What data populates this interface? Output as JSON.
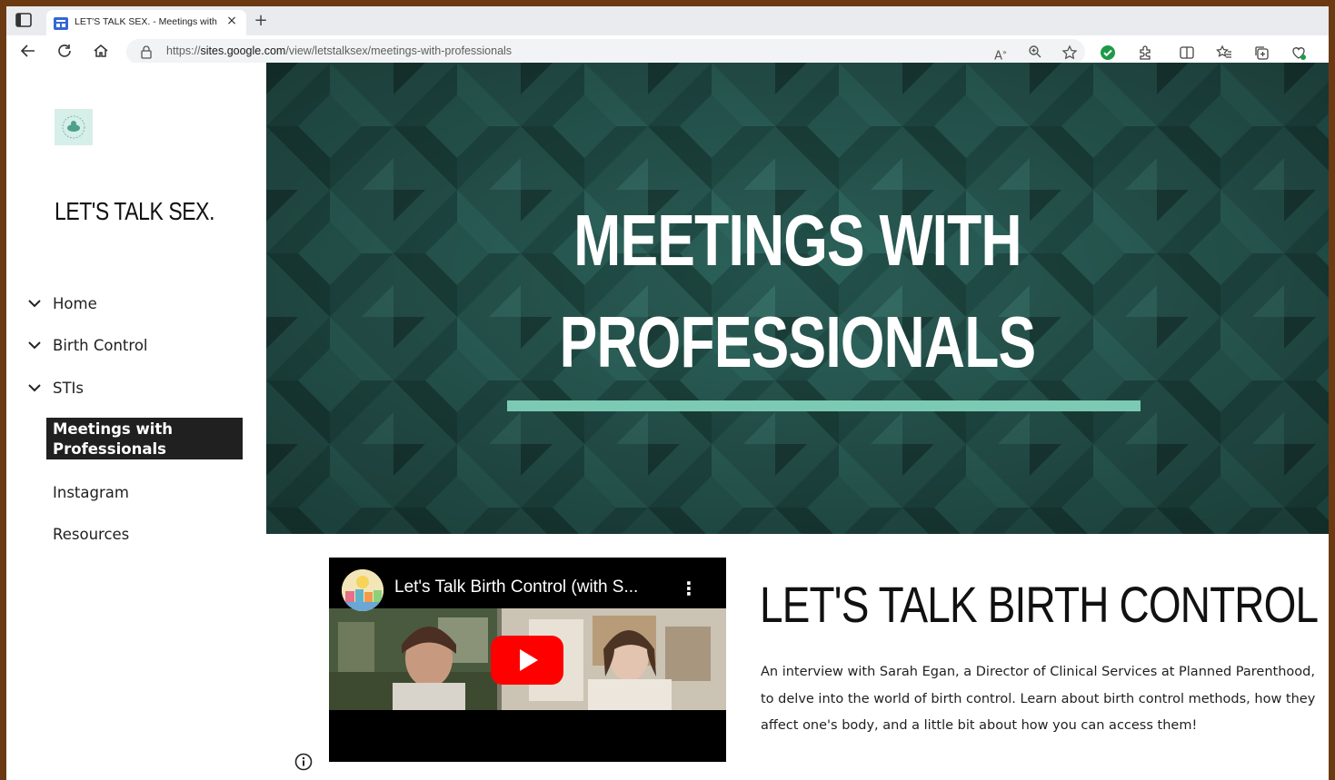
{
  "browser": {
    "tab_title": "LET'S TALK SEX. - Meetings with",
    "tab_close": "×",
    "new_tab": "+",
    "url_scheme": "https://",
    "url_host": "sites.google.com",
    "url_path": "/view/letstalksex/meetings-with-professionals",
    "icons": [
      "tab-actions-icon",
      "back-icon",
      "refresh-icon",
      "home-icon",
      "lock-icon",
      "read-aloud-icon",
      "zoom-icon",
      "favorite-star-icon",
      "extension-check-icon",
      "extensions-icon",
      "split-screen-icon",
      "favorites-icon",
      "collections-icon",
      "browser-essentials-icon"
    ]
  },
  "sidebar": {
    "site_title": "LET'S TALK SEX.",
    "items": [
      {
        "label": "Home",
        "has_chevron": true
      },
      {
        "label": "Birth Control",
        "has_chevron": true
      },
      {
        "label": "STIs",
        "has_chevron": true
      },
      {
        "label": "Meetings with Professionals",
        "active": true
      },
      {
        "label": "Instagram"
      },
      {
        "label": "Resources"
      }
    ]
  },
  "hero": {
    "title_line1": "MEETINGS WITH",
    "title_line2": "PROFESSIONALS",
    "colors": {
      "background": "#26564f",
      "rule": "#7cc9b4"
    }
  },
  "video": {
    "title": "Let's Talk Birth Control (with S...",
    "menu_glyph": "⋮"
  },
  "section": {
    "title": "LET'S TALK BIRTH CONTROL",
    "body": "An interview with Sarah Egan, a Director of Clinical Services at Planned Parenthood, to delve into the world of birth control. Learn about birth control methods, how they affect one's body, and a little bit about how you can access them!"
  }
}
